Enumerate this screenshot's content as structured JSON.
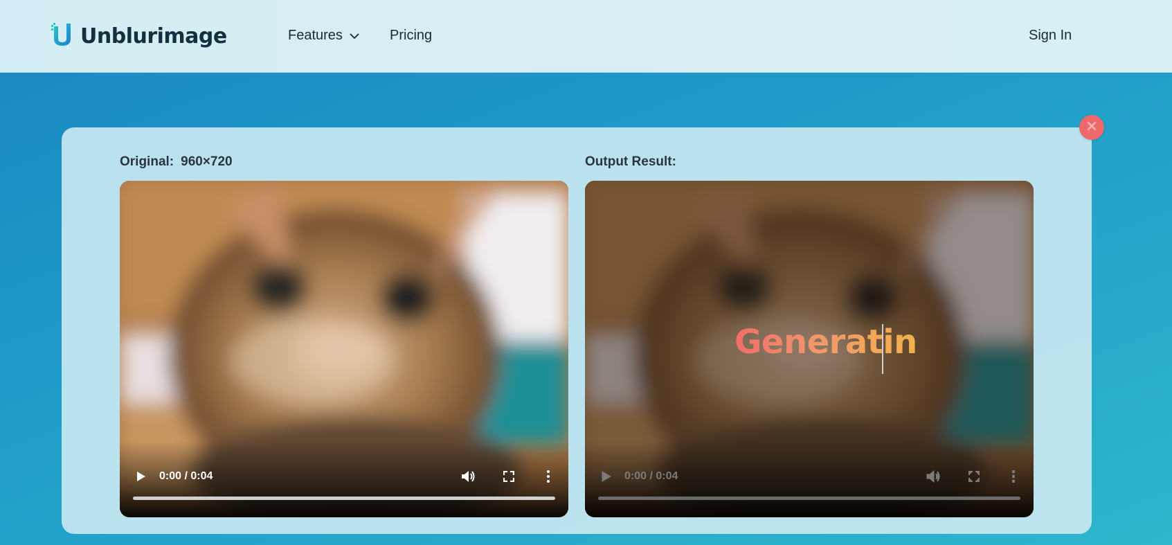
{
  "header": {
    "brand": "Unblurimage",
    "nav": {
      "features": "Features",
      "pricing": "Pricing",
      "signin": "Sign In"
    }
  },
  "panel": {
    "original": {
      "label": "Original:",
      "dimensions": "960×720",
      "player": {
        "time": "0:00 / 0:04"
      }
    },
    "output": {
      "label": "Output Result:",
      "status": "Generatin",
      "player": {
        "time": "0:00 / 0:04"
      }
    }
  },
  "colors": {
    "accent": "#1f9cc8",
    "close": "#ee6a6a",
    "generating_gradient": [
      "#f26d6a",
      "#f3b24d"
    ]
  },
  "icons": [
    "logo-icon",
    "chevron-down-icon",
    "close-icon",
    "play-icon",
    "volume-icon",
    "fullscreen-icon",
    "more-vertical-icon"
  ]
}
